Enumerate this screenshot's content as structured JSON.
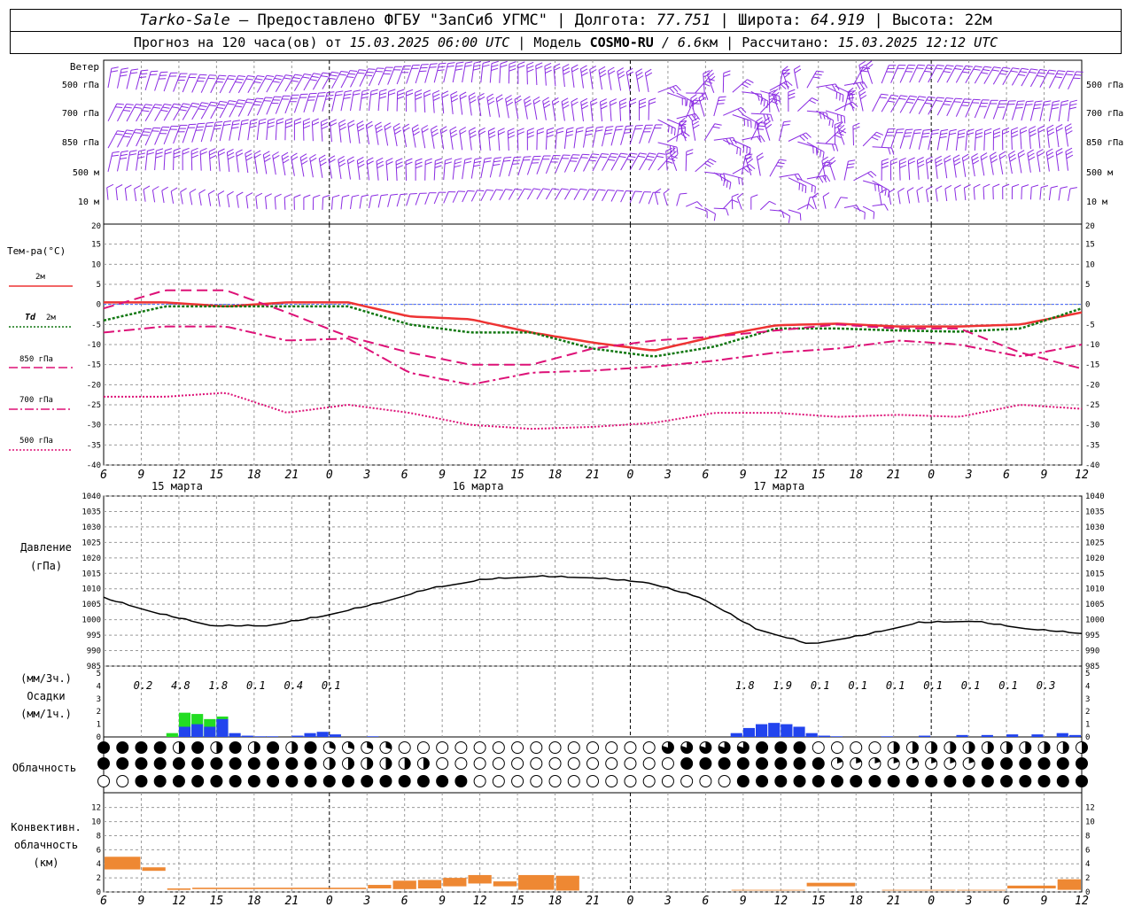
{
  "header": {
    "station": "Tarko-Sale",
    "dash": " – ",
    "provider": "Предоставлено ФГБУ \"ЗапСиб УГМС\"",
    "sep": " | ",
    "lon_label": "Долгота: ",
    "lon": "77.751",
    "lat_label": "Широта: ",
    "lat": "64.919",
    "alt_label": "Высота: ",
    "alt": "22м",
    "forecast_label": "Прогноз на 120 часа(ов) от ",
    "forecast_time": "15.03.2025 06:00 UTC",
    "model_label": "Модель ",
    "model": "COSMO-RU",
    "model_res": " / 6.6",
    "model_res_unit": "км",
    "calc_label": "Рассчитано: ",
    "calc_time": "15.03.2025 12:12 UTC"
  },
  "colors": {
    "wind": "#8a2be2",
    "t2m": "#ee3333",
    "td2m": "#117711",
    "level": "#dd1177",
    "precip_green": "#22dd22",
    "precip_blue": "#2244ee",
    "conv": "#ee8833",
    "grid": "#999999"
  },
  "chart_data": [
    {
      "type": "wind-barbs",
      "panel_label": "Ветер",
      "levels": [
        "500 гПа",
        "700 гПа",
        "850 гПа",
        "500 м",
        "10 м"
      ],
      "y_tick": "20"
    },
    {
      "type": "line",
      "panel_label": "Тем-ра(°C)",
      "ylim": [
        -40,
        20
      ],
      "yticks": [
        20,
        15,
        10,
        5,
        0,
        -5,
        -10,
        -15,
        -20,
        -25,
        -30,
        -35,
        -40
      ],
      "x_hours": [
        0,
        6,
        12,
        18,
        24,
        30,
        36,
        42,
        48,
        54,
        60,
        66,
        72,
        78
      ],
      "series": [
        {
          "name": "2м",
          "values": [
            0.5,
            0.5,
            -0.5,
            0.5,
            0.5,
            -3,
            -3.7,
            -7,
            -9.5,
            -11.5,
            -8,
            -5.2,
            -4.8,
            -5.5,
            -5.5,
            -5,
            -2
          ]
        },
        {
          "name": "Td 2м",
          "values": [
            -4,
            -0.5,
            -0.5,
            -0.5,
            -0.5,
            -5,
            -7,
            -7,
            -11,
            -13,
            -10.5,
            -6,
            -6,
            -6.5,
            -6.8,
            -6,
            -1
          ]
        },
        {
          "name": "850 гПа",
          "values": [
            -1,
            3.5,
            3.5,
            -2,
            -8,
            -12,
            -15,
            -15,
            -11,
            -9,
            -8,
            -6.5,
            -5,
            -6,
            -6,
            -12,
            -16
          ]
        },
        {
          "name": "700 гПа",
          "values": [
            -7,
            -5.5,
            -5.5,
            -9,
            -8.5,
            -17,
            -20,
            -17,
            -16.5,
            -15.5,
            -14,
            -12,
            -11,
            -9,
            -10,
            -13,
            -10
          ]
        },
        {
          "name": "500 гПа",
          "values": [
            -23,
            -23,
            -22,
            -27,
            -25,
            -27,
            -30,
            -31,
            -30.5,
            -29.5,
            -27,
            -27,
            -28,
            -27.5,
            -28,
            -25,
            -26
          ]
        }
      ],
      "legend": [
        {
          "name": "2м",
          "label": "2м"
        },
        {
          "name": "Td 2м",
          "label_a": "Td",
          "label_b": "2м"
        },
        {
          "name": "850 гПа",
          "label": "850 гПа"
        },
        {
          "name": "700 гПа",
          "label": "700 гПа"
        },
        {
          "name": "500 гПа",
          "label": "500 гПа"
        }
      ]
    },
    {
      "type": "line",
      "panel_label_a": "Давление",
      "panel_label_b": "(гПа)",
      "ylim": [
        985,
        1040
      ],
      "yticks": [
        1040,
        1035,
        1030,
        1025,
        1020,
        1015,
        1010,
        1005,
        1000,
        995,
        990,
        985
      ],
      "series": [
        {
          "name": "Давление",
          "values": [
            1007,
            1002,
            998,
            998,
            1001,
            1005,
            1010,
            1013,
            1014,
            1013.5,
            1012,
            1007,
            997,
            992,
            995,
            999,
            999.5,
            997,
            995.5
          ]
        }
      ]
    },
    {
      "type": "bar",
      "panel_label_a": "(мм/3ч.)",
      "panel_label_b": "Осадки",
      "panel_label_c": "(мм/1ч.)",
      "ylim": [
        0,
        5
      ],
      "yticks": [
        5,
        4,
        3,
        2,
        1,
        0
      ],
      "sums_3h": [
        "0.2",
        "4.8",
        "1.8",
        "0.1",
        "0.4",
        "0.1",
        "1.8",
        "1.9",
        "0.1",
        "0.1",
        "0.1",
        "0.1",
        "0.1",
        "0.1",
        "0.3"
      ],
      "hourly_peak_mm": 1.9
    },
    {
      "type": "cloud-symbols",
      "panel_label": "Облачность",
      "rows": 3
    },
    {
      "type": "bar",
      "panel_label_a": "Конвективн.",
      "panel_label_b": "облачность",
      "panel_label_c": "(км)",
      "ylim": [
        0,
        14
      ],
      "yticks": [
        12,
        10,
        8,
        6,
        4,
        2,
        0
      ],
      "peak_km": 5
    }
  ],
  "xaxis": {
    "hour_ticks": [
      "6",
      "9",
      "12",
      "15",
      "18",
      "21",
      "0",
      "3",
      "6",
      "9",
      "12",
      "15",
      "18",
      "21",
      "0",
      "3",
      "6",
      "9",
      "12",
      "15",
      "18",
      "21",
      "0",
      "3",
      "6",
      "9",
      "12"
    ],
    "dates": [
      "15 марта",
      "16 марта",
      "17 марта"
    ]
  }
}
